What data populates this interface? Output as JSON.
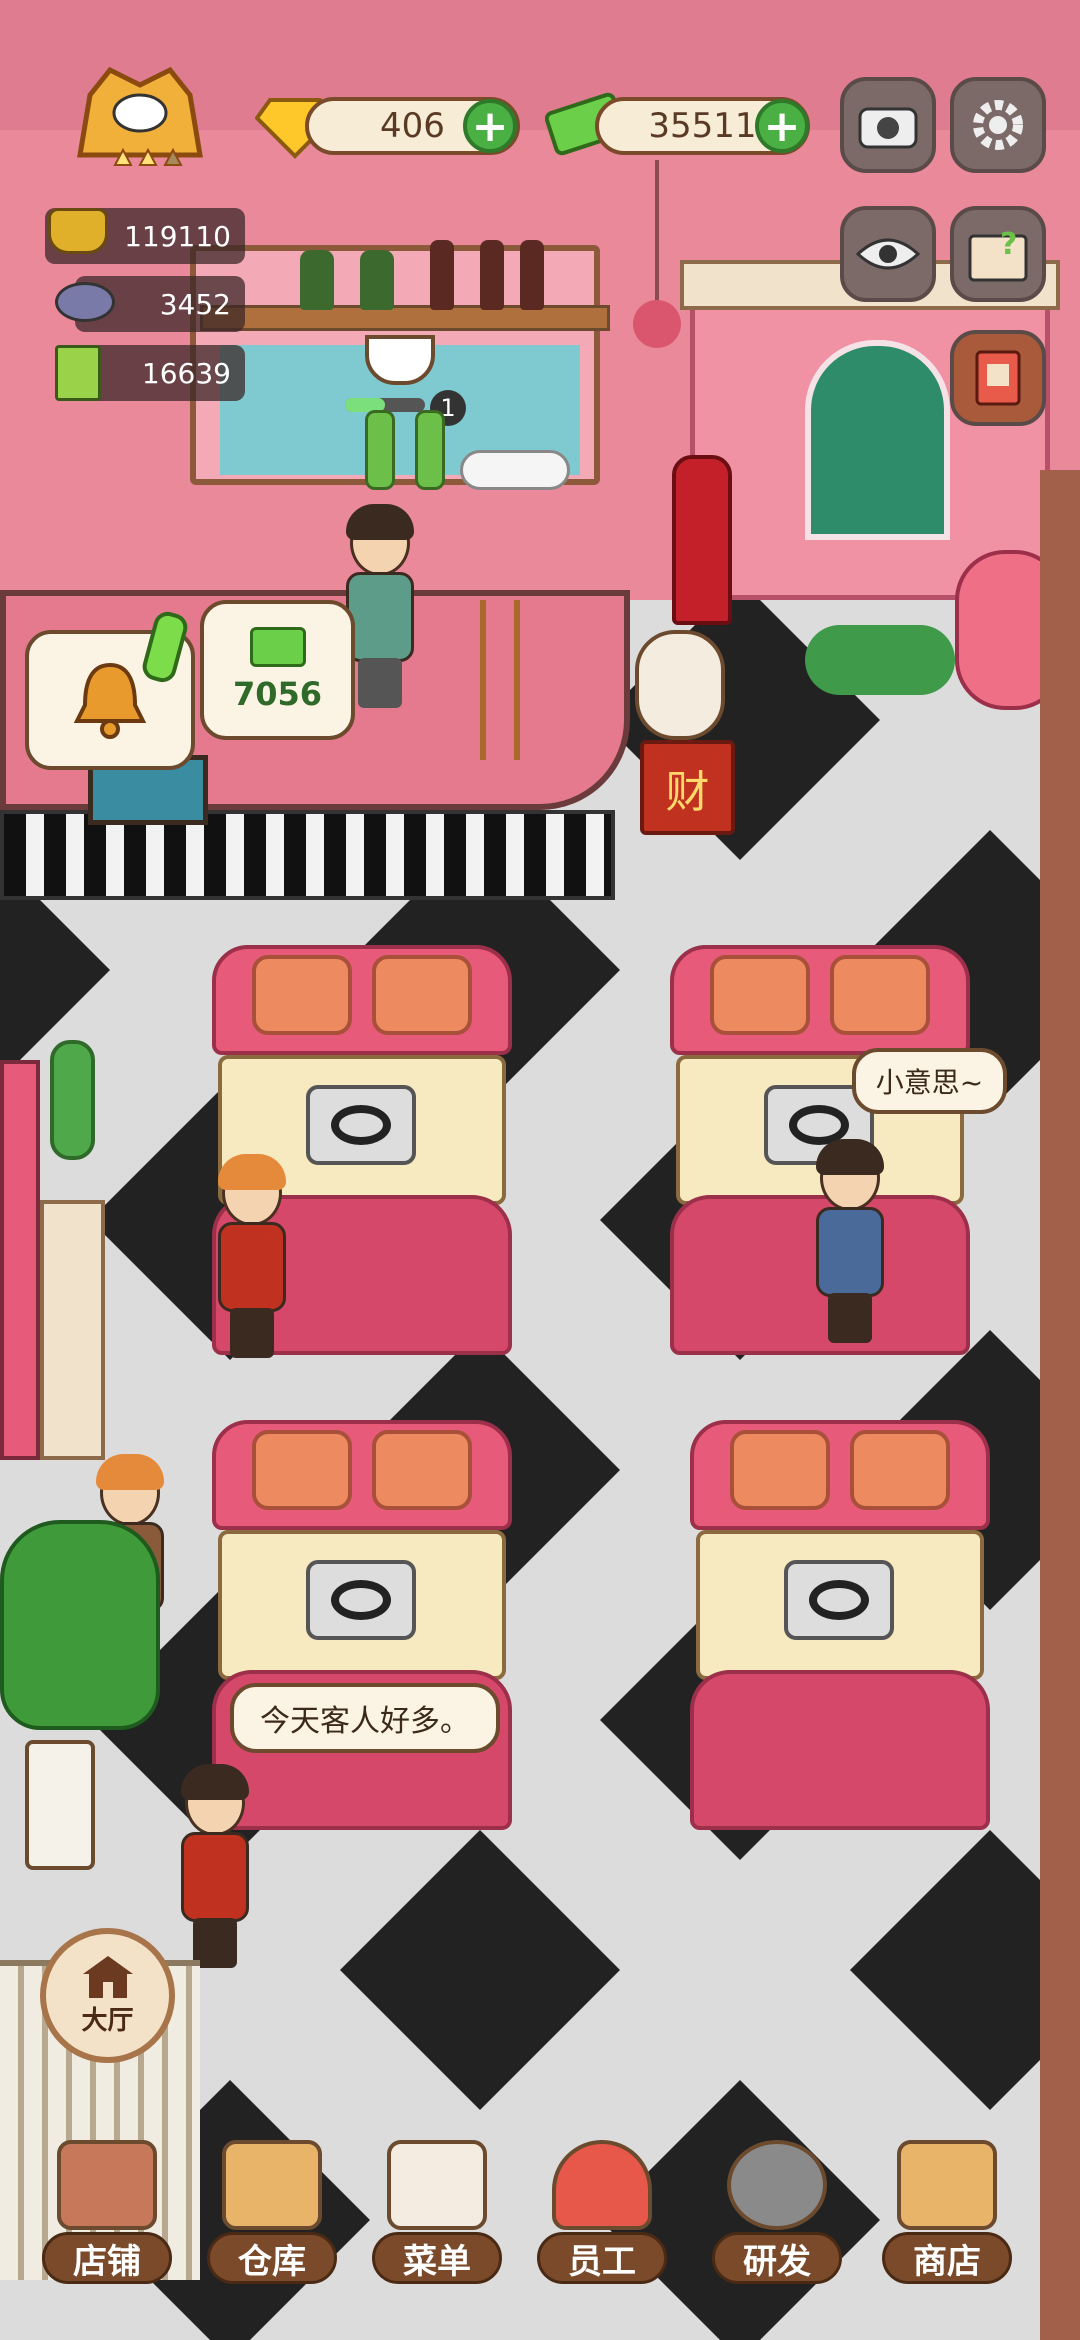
{
  "top_bar": {
    "gems": "406",
    "cash": "35511"
  },
  "stats": {
    "coins": "119110",
    "fish": "3452",
    "menu": "16639"
  },
  "counter": {
    "tip_amount": "7056",
    "cup_badge": "1",
    "fortune_char": "财"
  },
  "bubbles": {
    "waiter": "小意思~",
    "chef": "今天客人好多。"
  },
  "hall_button": "大厅",
  "nav": [
    {
      "label": "店铺"
    },
    {
      "label": "仓库"
    },
    {
      "label": "菜单"
    },
    {
      "label": "员工"
    },
    {
      "label": "研发"
    },
    {
      "label": "商店"
    }
  ],
  "colors": {
    "wall": "#e9899a",
    "booth": "#d6486a",
    "floor_dark": "#222222",
    "floor_light": "#dcdcdc"
  }
}
